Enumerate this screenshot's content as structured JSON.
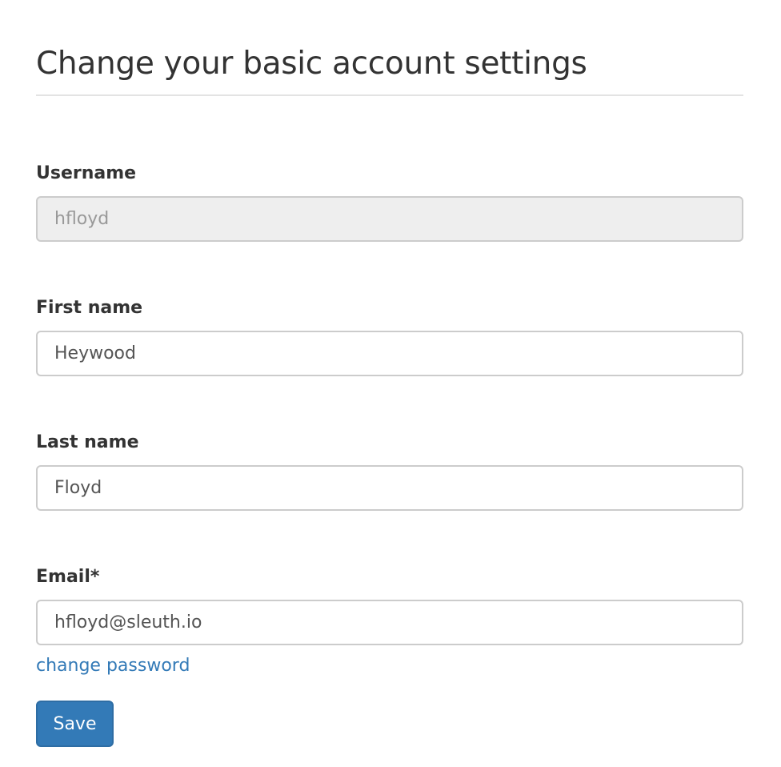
{
  "page": {
    "title": "Change your basic account settings"
  },
  "form": {
    "username": {
      "label": "Username",
      "value": "hfloyd"
    },
    "first_name": {
      "label": "First name",
      "value": "Heywood"
    },
    "last_name": {
      "label": "Last name",
      "value": "Floyd"
    },
    "email": {
      "label": "Email*",
      "value": "hfloyd@sleuth.io"
    },
    "change_password_label": "change password",
    "save_label": "Save"
  },
  "colors": {
    "link": "#337ab7",
    "primary_button": "#337ab7",
    "disabled_input_bg": "#eeeeee",
    "text": "#333333"
  }
}
